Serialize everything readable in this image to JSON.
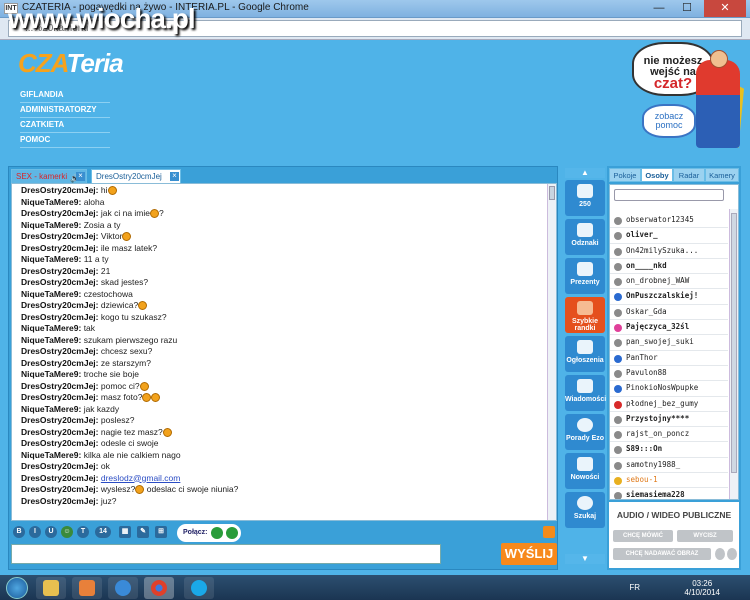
{
  "window": {
    "title": "CZATERIA - pogawędki na żywo - INTERIA.PL - Google Chrome",
    "app_icon": "INT",
    "url": "...%20kamerki",
    "minimize": "—",
    "maximize": "☐",
    "close": "✕"
  },
  "watermark": "www.wiocha.pl",
  "logo": {
    "part1": "CZA",
    "part2": "Teria"
  },
  "nav": [
    "GIFLANDIA",
    "ADMINISTRATORZY",
    "CZATKIETA",
    "POMOC"
  ],
  "promo": {
    "line1": "nie możesz",
    "line2": "wejść na",
    "line3": "czat?",
    "zobacz": "zobacz",
    "pomoc": "pomoc"
  },
  "tabs": [
    {
      "label": "SEX - kamerki"
    },
    {
      "label": "DresOstry20cmJej"
    }
  ],
  "messages": [
    {
      "nick": "DresOstry20cmJej:",
      "text": "hi",
      "smileys": 1
    },
    {
      "nick": "NiqueTaMere9:",
      "text": "aloha"
    },
    {
      "nick": "DresOstry20cmJej:",
      "text": "jak ci na imie",
      "smileys": 1,
      "after": "?"
    },
    {
      "nick": "NiqueTaMere9:",
      "text": "Zosia a ty"
    },
    {
      "nick": "DresOstry20cmJej:",
      "text": "Viktor",
      "smileys": 1
    },
    {
      "nick": "DresOstry20cmJej:",
      "text": "ile masz latek?"
    },
    {
      "nick": "NiqueTaMere9:",
      "text": "11 a ty"
    },
    {
      "nick": "DresOstry20cmJej:",
      "text": "21"
    },
    {
      "nick": "DresOstry20cmJej:",
      "text": "skad jestes?"
    },
    {
      "nick": "NiqueTaMere9:",
      "text": "czestochowa"
    },
    {
      "nick": "DresOstry20cmJej:",
      "text": "dziewica?",
      "smileys": 1
    },
    {
      "nick": "DresOstry20cmJej:",
      "text": "kogo tu szukasz?"
    },
    {
      "nick": "NiqueTaMere9:",
      "text": "tak"
    },
    {
      "nick": "NiqueTaMere9:",
      "text": "szukam pierwszego razu"
    },
    {
      "nick": "DresOstry20cmJej:",
      "text": "chcesz sexu?"
    },
    {
      "nick": "DresOstry20cmJej:",
      "text": "ze starszym?"
    },
    {
      "nick": "NiqueTaMere9:",
      "text": "troche sie boje"
    },
    {
      "nick": "DresOstry20cmJej:",
      "text": "pomoc ci?",
      "smileys": 1
    },
    {
      "nick": "DresOstry20cmJej:",
      "text": "masz foto?",
      "smileys": 2
    },
    {
      "nick": "NiqueTaMere9:",
      "text": "jak kazdy"
    },
    {
      "nick": "DresOstry20cmJej:",
      "text": "poslesz?"
    },
    {
      "nick": "DresOstry20cmJej:",
      "text": "nagie tez masz?",
      "smileys": 1
    },
    {
      "nick": "DresOstry20cmJej:",
      "text": "odesle ci swoje"
    },
    {
      "nick": "NiqueTaMere9:",
      "text": "kilka ale nie calkiem nago"
    },
    {
      "nick": "DresOstry20cmJej:",
      "text": "ok"
    },
    {
      "nick": "DresOstry20cmJej:",
      "text": "",
      "link": "dreslodz@gmail.com"
    },
    {
      "nick": "DresOstry20cmJej:",
      "text": "wyslesz?",
      "smileys": 1,
      "after": " odeslac ci swoje niunia?"
    },
    {
      "nick": "DresOstry20cmJej:",
      "text": "juz?"
    }
  ],
  "toolbar": {
    "buttons": [
      "B",
      "I",
      "U",
      "☺",
      "T",
      "14",
      "▦",
      "✎",
      "⊞"
    ],
    "polacz": "Połącz:"
  },
  "input": {
    "value": "",
    "send": "WYŚLIJ"
  },
  "sidebar": {
    "items": [
      {
        "label": "250",
        "active": false
      },
      {
        "label": "Odznaki",
        "active": false
      },
      {
        "label": "Prezenty",
        "active": false
      },
      {
        "label": "Szybkie randki",
        "active": true
      },
      {
        "label": "Ogłoszenia",
        "active": false
      },
      {
        "label": "Wiadomości",
        "active": false
      },
      {
        "label": "Porady Ezo",
        "active": false
      },
      {
        "label": "Nowości",
        "active": false
      },
      {
        "label": "Szukaj",
        "active": false
      }
    ],
    "up": "▲",
    "down": "▼"
  },
  "right_tabs": [
    {
      "label": "Pokoje"
    },
    {
      "label": "Osoby",
      "active": true
    },
    {
      "label": "Radar"
    },
    {
      "label": "Kamery"
    }
  ],
  "users": [
    {
      "name": "obserwator12345",
      "style": ""
    },
    {
      "name": "oliver_",
      "style": "bold"
    },
    {
      "name": "On42milySzuka...",
      "style": ""
    },
    {
      "name": "on____nkd",
      "style": "bold"
    },
    {
      "name": "on_drobnej_WAW",
      "style": ""
    },
    {
      "name": "OnPuszczalskiej!",
      "style": "bold blue"
    },
    {
      "name": "Oskar_Gda",
      "style": ""
    },
    {
      "name": "Pajęczyca_32śl",
      "style": "bold pink"
    },
    {
      "name": "pan_swojej_suki",
      "style": ""
    },
    {
      "name": "PanThor",
      "style": "blue"
    },
    {
      "name": "Pavulon88",
      "style": ""
    },
    {
      "name": "PinokioNosWpupke",
      "style": "blue"
    },
    {
      "name": "płodnej_bez_gumy",
      "style": "red"
    },
    {
      "name": "Przystojny****",
      "style": "bold"
    },
    {
      "name": "rajst_on_poncz",
      "style": ""
    },
    {
      "name": "S89:::On",
      "style": "bold"
    },
    {
      "name": "samotny1988_",
      "style": ""
    },
    {
      "name": "sebou-1",
      "style": "yellow orange"
    },
    {
      "name": "siemasiema228",
      "style": "bold"
    }
  ],
  "av": {
    "title": "AUDIO / WIDEO PUBLICZNE",
    "btn1": "CHCĘ MÓWIĆ",
    "btn2": "WYCISZ",
    "btn3": "CHCĘ NADAWAĆ OBRAZ"
  },
  "taskbar": {
    "lang": "FR",
    "time": "03:26",
    "date": "4/10/2014"
  }
}
